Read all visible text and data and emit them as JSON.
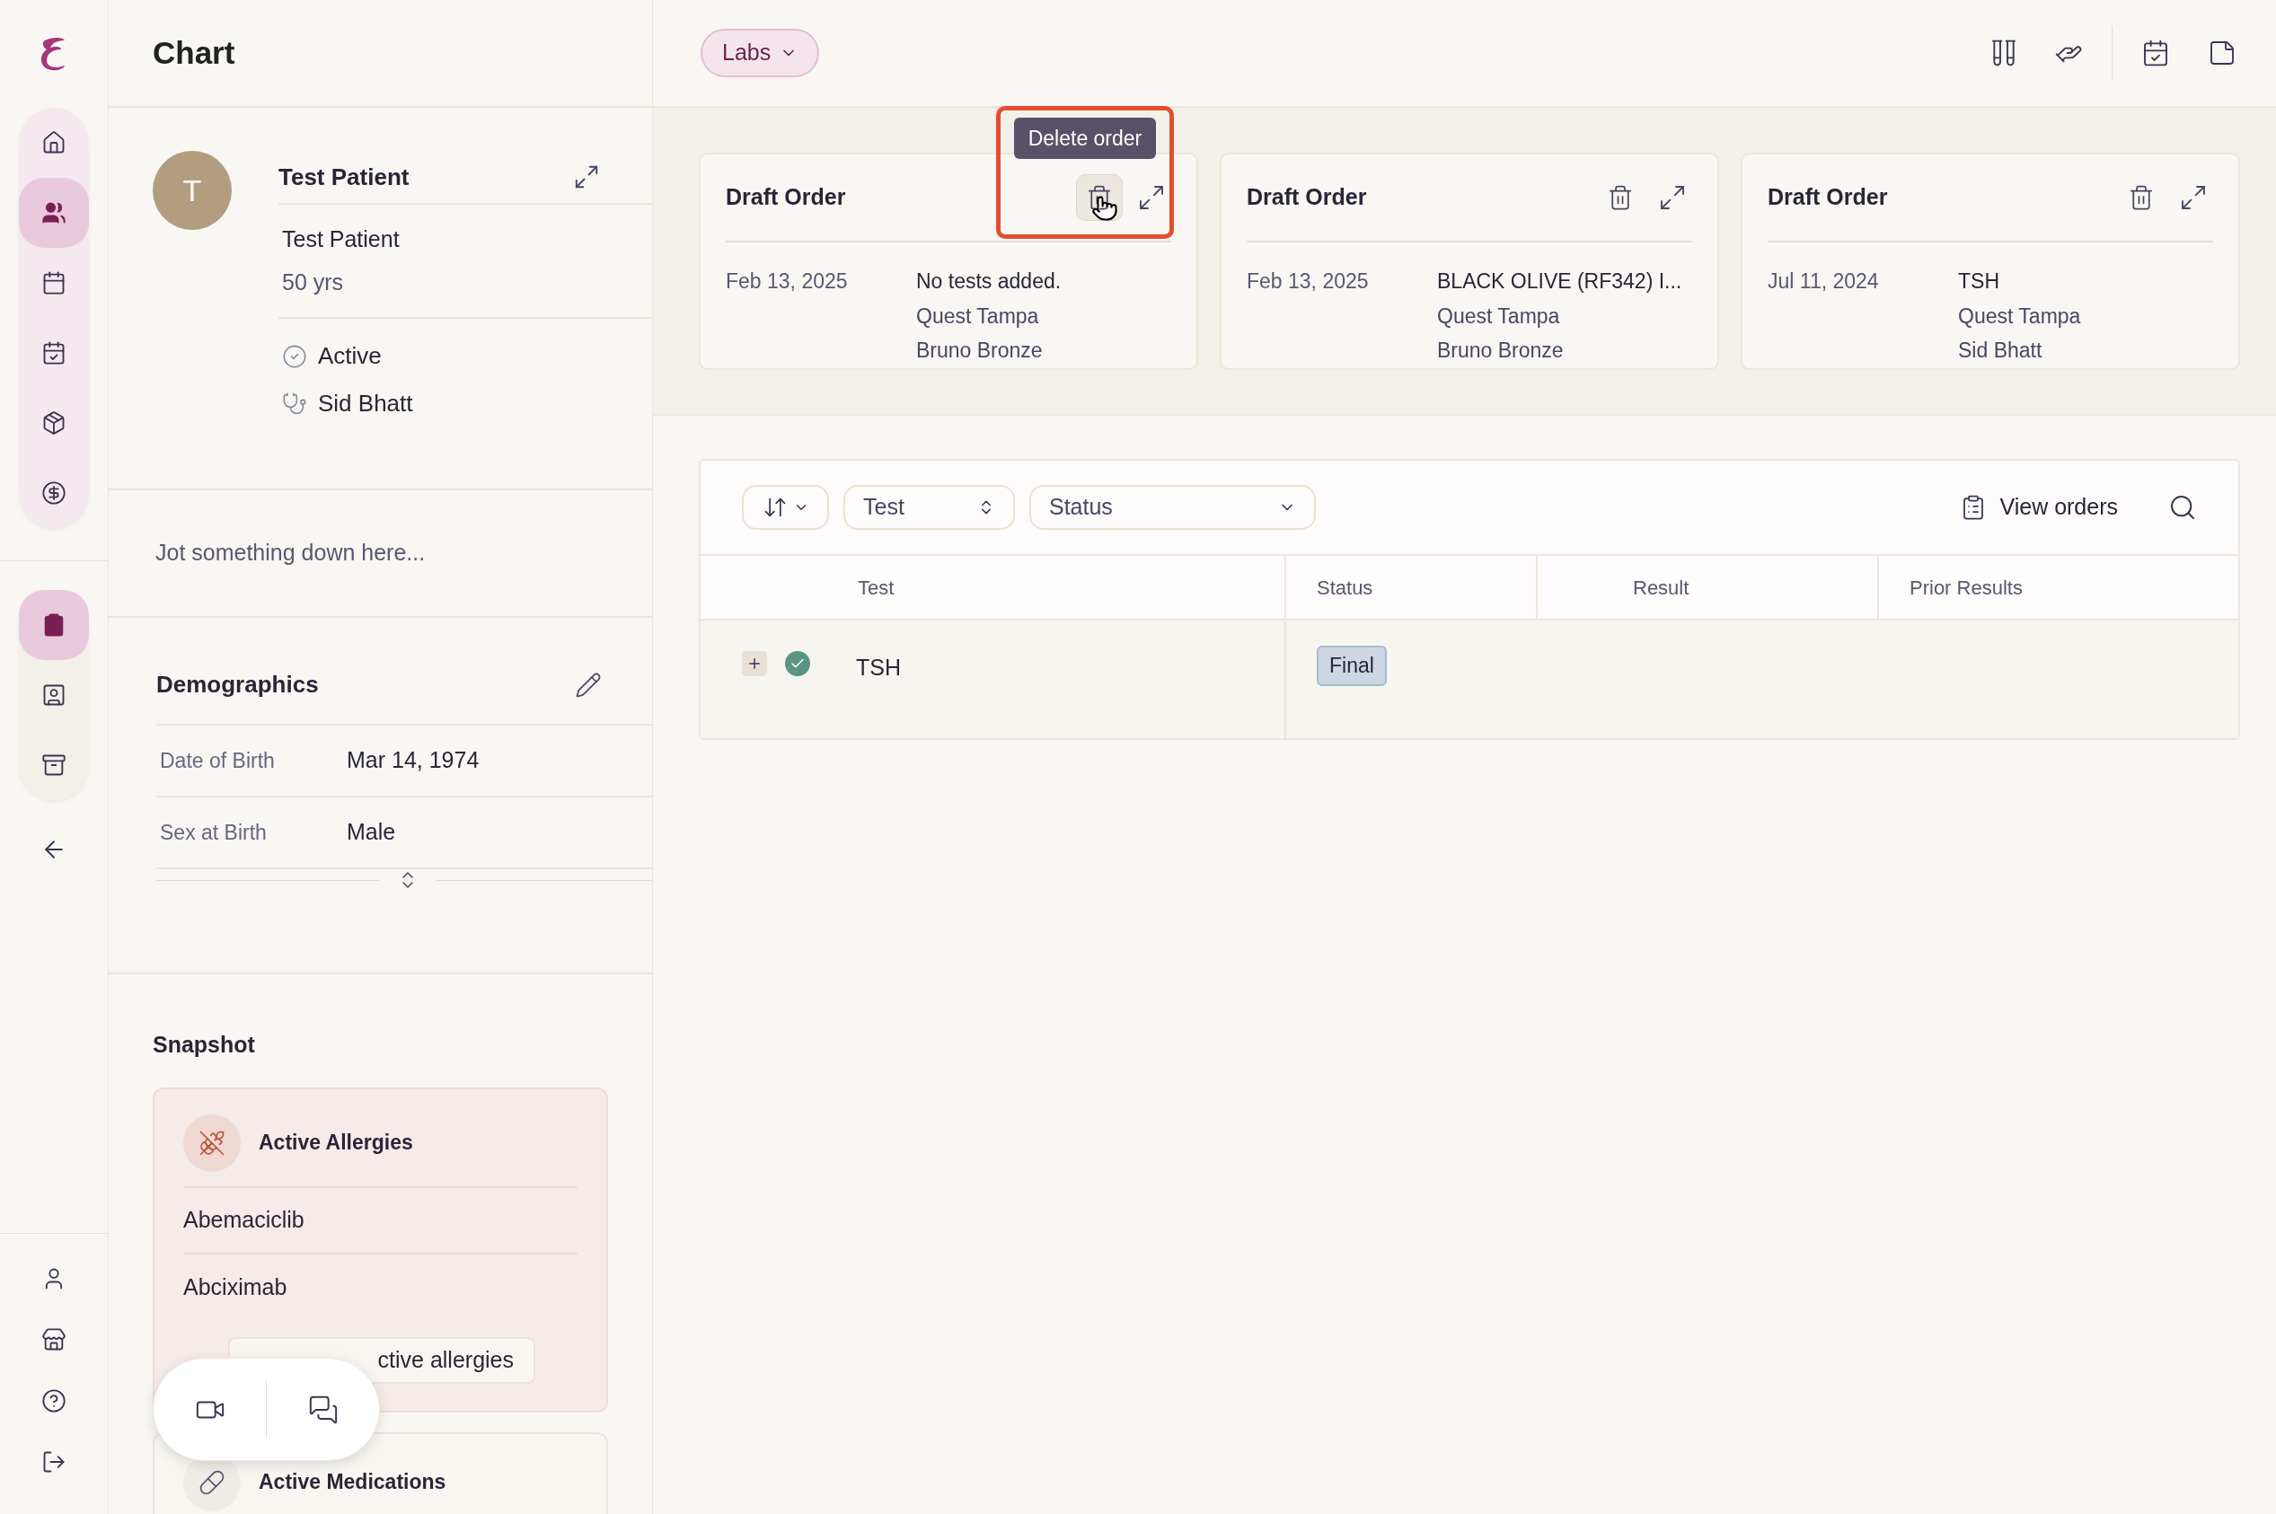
{
  "nav_primary": [
    {
      "kind": "home",
      "selected": false
    },
    {
      "kind": "patients",
      "selected": true
    },
    {
      "kind": "calendar",
      "selected": false
    },
    {
      "kind": "schedule",
      "selected": false
    },
    {
      "kind": "box",
      "selected": false
    },
    {
      "kind": "billing",
      "selected": false
    }
  ],
  "nav_secondary": [
    {
      "kind": "chart",
      "selected": true
    },
    {
      "kind": "badge",
      "selected": false
    },
    {
      "kind": "archive",
      "selected": false
    }
  ],
  "nav_bottom": [
    {
      "kind": "user"
    },
    {
      "kind": "store"
    },
    {
      "kind": "help"
    },
    {
      "kind": "logout"
    }
  ],
  "panel": {
    "title": "Chart",
    "patient": {
      "initial": "T",
      "name": "Test Patient",
      "full_name": "Test Patient",
      "age": "50 yrs",
      "status": "Active",
      "provider": "Sid Bhatt"
    },
    "note": {
      "placeholder": "Jot something down here..."
    },
    "demographics": {
      "title": "Demographics",
      "rows": [
        {
          "label": "Date of Birth",
          "value": "Mar 14, 1974"
        },
        {
          "label": "Sex at Birth",
          "value": "Male"
        }
      ]
    },
    "snapshot": {
      "title": "Snapshot",
      "allergies": {
        "title": "Active Allergies",
        "items": [
          "Abemaciclib",
          "Abciximab"
        ],
        "button": "ctive allergies"
      },
      "medications": {
        "title": "Active Medications"
      }
    }
  },
  "main": {
    "view_select": "Labs",
    "orders": [
      {
        "title": "Draft Order",
        "date": "Feb 13, 2025",
        "lines": [
          "No tests added.",
          "Quest Tampa",
          "Bruno Bronze"
        ],
        "hovered": true
      },
      {
        "title": "Draft Order",
        "date": "Feb 13, 2025",
        "lines": [
          "BLACK OLIVE (RF342) I...",
          "Quest Tampa",
          "Bruno Bronze"
        ],
        "hovered": false
      },
      {
        "title": "Draft Order",
        "date": "Jul 11, 2024",
        "lines": [
          "TSH",
          "Quest Tampa",
          "Sid Bhatt"
        ],
        "hovered": false
      }
    ],
    "tooltip": "Delete order",
    "toolbar": {
      "test_select": "Test",
      "status_select": "Status",
      "view_orders": "View orders"
    },
    "table": {
      "columns": [
        "Test",
        "Status",
        "Result",
        "Prior Results"
      ],
      "rows": [
        {
          "test": "TSH",
          "status": "Final",
          "done": true
        }
      ]
    }
  }
}
